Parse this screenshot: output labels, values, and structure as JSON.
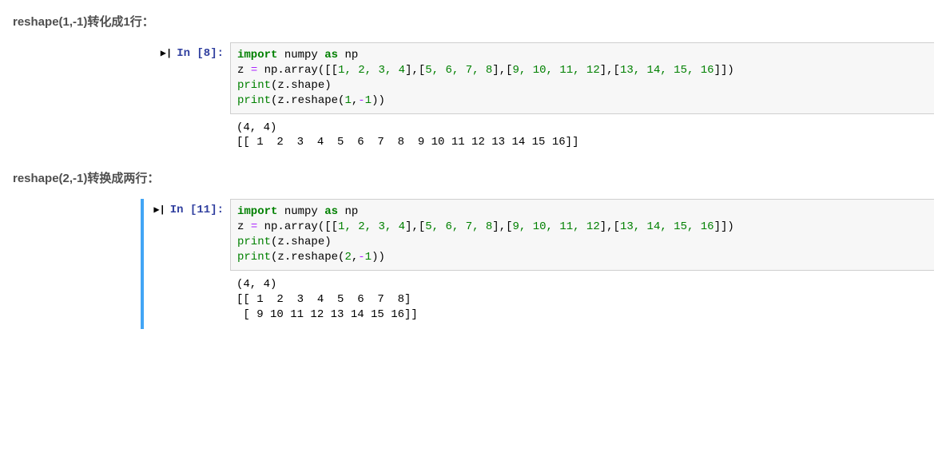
{
  "section1": {
    "heading": "reshape(1,-1)转化成1行：",
    "prompt_arrow": "▶|",
    "prompt_label": "In [8]:",
    "code": {
      "l1a": "import",
      "l1b": " numpy ",
      "l1c": "as",
      "l1d": " np",
      "l2a": "z ",
      "l2b": "=",
      "l2c": " np.array([[",
      "l2n": "1, 2, 3, 4",
      "l2d": "],[",
      "l2n2": "5, 6, 7, 8",
      "l2e": "],[",
      "l2n3": "9, 10, 11, 12",
      "l2f": "],[",
      "l2n4": "13, 14, 15, 16",
      "l2g": "]])",
      "l3a": "print",
      "l3b": "(z.shape)",
      "l4a": "print",
      "l4b": "(z.reshape(",
      "l4n": "1",
      "l4c": ",",
      "l4m": "-",
      "l4n2": "1",
      "l4d": "))"
    },
    "output": "(4, 4)\n[[ 1  2  3  4  5  6  7  8  9 10 11 12 13 14 15 16]]"
  },
  "section2": {
    "heading": "reshape(2,-1)转换成两行：",
    "prompt_arrow": "▶|",
    "prompt_label": "In [11]:",
    "code": {
      "l1a": "import",
      "l1b": " numpy ",
      "l1c": "as",
      "l1d": " np",
      "l2a": "z ",
      "l2b": "=",
      "l2c": " np.array([[",
      "l2n": "1, 2, 3, 4",
      "l2d": "],[",
      "l2n2": "5, 6, 7, 8",
      "l2e": "],[",
      "l2n3": "9, 10, 11, 12",
      "l2f": "],[",
      "l2n4": "13, 14, 15, 16",
      "l2g": "]])",
      "l3a": "print",
      "l3b": "(z.shape)",
      "l4a": "print",
      "l4b": "(z.reshape(",
      "l4n": "2",
      "l4c": ",",
      "l4m": "-",
      "l4n2": "1",
      "l4d": "))"
    },
    "output": "(4, 4)\n[[ 1  2  3  4  5  6  7  8]\n [ 9 10 11 12 13 14 15 16]]"
  }
}
